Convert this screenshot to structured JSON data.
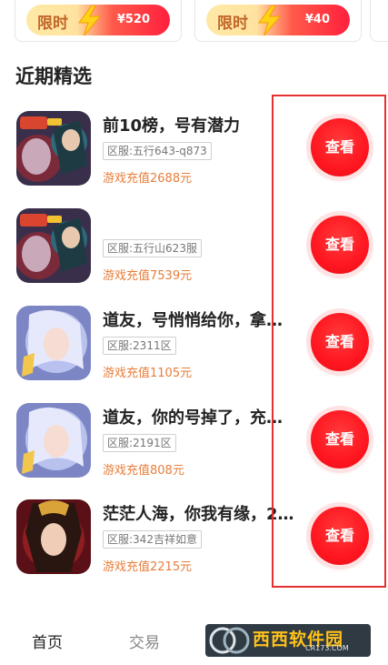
{
  "promos": [
    {
      "label": "限时",
      "price": "¥520"
    },
    {
      "label": "限时",
      "price": "¥40"
    }
  ],
  "section_title": "近期精选",
  "games": [
    {
      "title": "前10榜，号有潜力",
      "server": "区服:五行643-q873",
      "recharge": "游戏充值2688元",
      "view": "查看",
      "icon": "three-kingdoms-icon"
    },
    {
      "title": "",
      "server": "区服:五行山623服",
      "recharge": "游戏充值7539元",
      "view": "查看",
      "icon": "three-kingdoms-icon"
    },
    {
      "title": "道友，号悄悄给你，拿…",
      "server": "区服:2311区",
      "recharge": "游戏充值1105元",
      "view": "查看",
      "icon": "fairy-girl-icon"
    },
    {
      "title": "道友，你的号掉了，充…",
      "server": "区服:2191区",
      "recharge": "游戏充值808元",
      "view": "查看",
      "icon": "fairy-girl-icon"
    },
    {
      "title": "茫茫人海，你我有缘，2…",
      "server": "区服:342吉祥如意",
      "recharge": "游戏充值2215元",
      "view": "查看",
      "icon": "empress-icon"
    }
  ],
  "tabs": {
    "home": "首页",
    "trade": "交易"
  },
  "watermark": {
    "text": "西西软件园",
    "url": "CR173.COM"
  },
  "colors": {
    "accent": "#ff1f2d",
    "recharge": "#e77d3a",
    "highlight": "#e53030"
  }
}
